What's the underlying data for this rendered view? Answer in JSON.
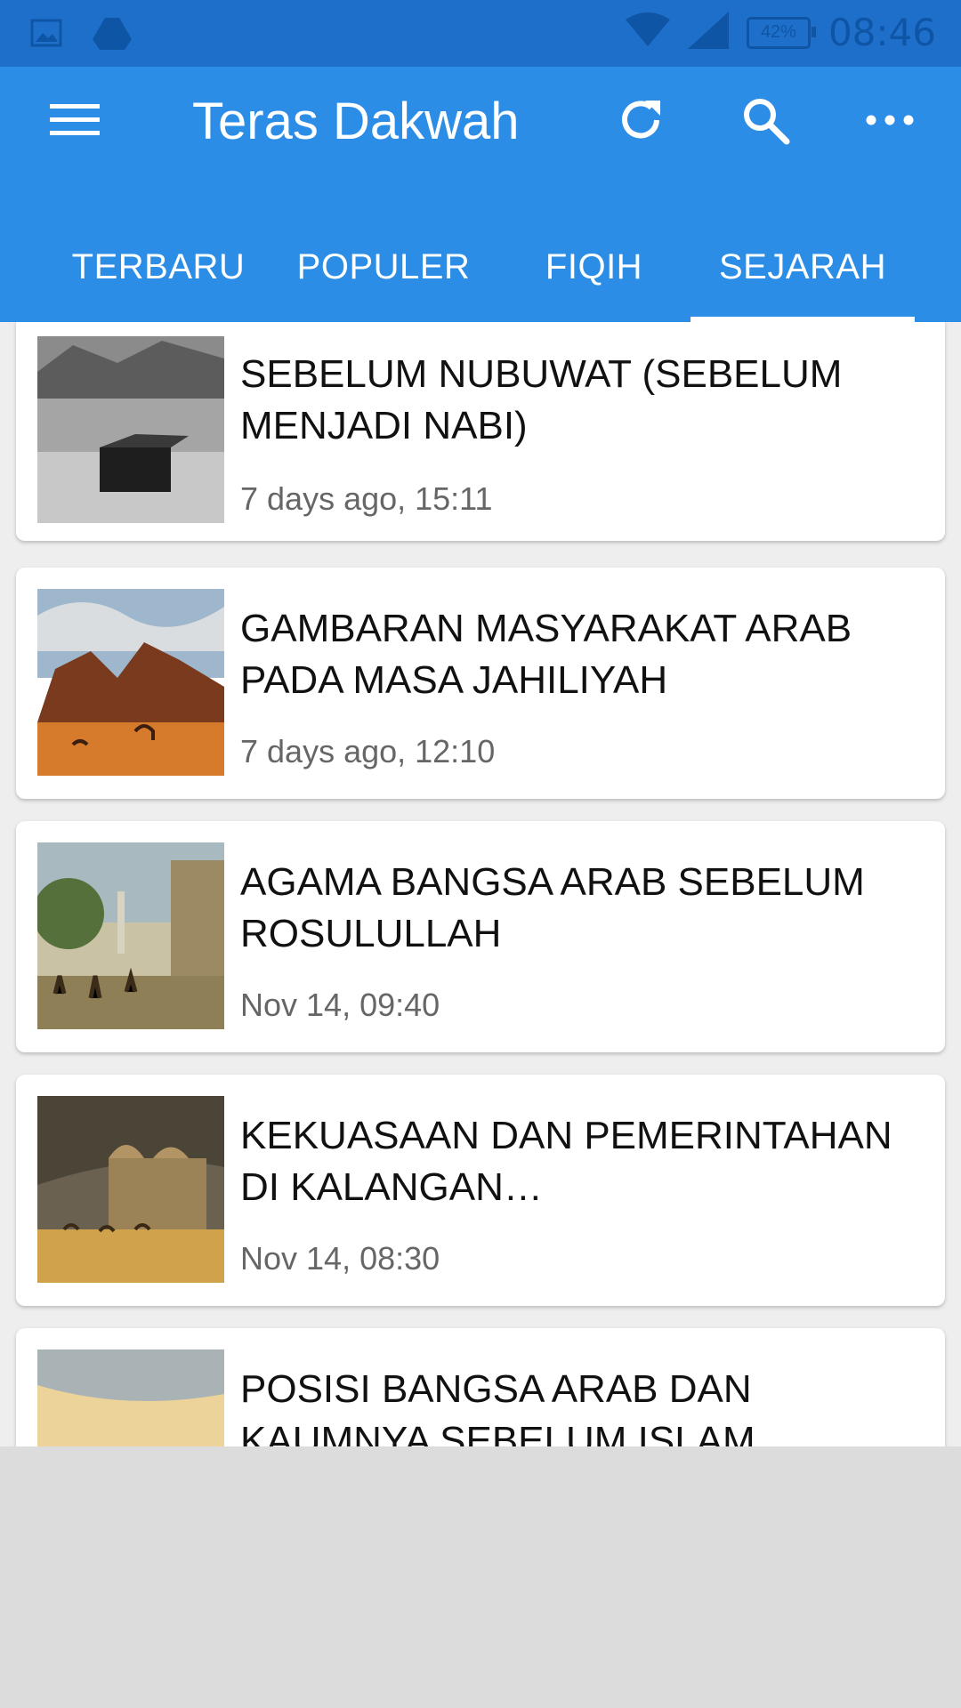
{
  "statusbar": {
    "battery": "42%",
    "time": "08:46"
  },
  "toolbar": {
    "title": "Teras Dakwah",
    "icons": [
      "menu-icon",
      "refresh-icon",
      "search-icon",
      "more-icon"
    ]
  },
  "tabs": [
    {
      "label": "TERBARU"
    },
    {
      "label": "POPULER"
    },
    {
      "label": "FIQIH"
    },
    {
      "label": "SEJARAH",
      "selected": true
    }
  ],
  "articles": [
    {
      "title": "SEBELUM NUBUWAT (SEBELUM MENJADI NABI)",
      "date": "7 days ago, 15:11"
    },
    {
      "title": "GAMBARAN MASYARAKAT ARAB PADA MASA JAHILIYAH",
      "date": "7 days ago, 12:10"
    },
    {
      "title": "AGAMA BANGSA ARAB SEBELUM ROSULULLAH",
      "date": "Nov 14, 09:40"
    },
    {
      "title": "KEKUASAAN DAN PEMERINTAHAN DI KALANGAN…",
      "date": "Nov 14, 08:30"
    },
    {
      "title": "POSISI BANGSA ARAB DAN KAUMNYA SEBELUM ISLAM",
      "date": ""
    }
  ],
  "colors": {
    "statusbar": "#1e6fca",
    "appbar": "#2b8de6",
    "background": "#dcdcdc"
  }
}
